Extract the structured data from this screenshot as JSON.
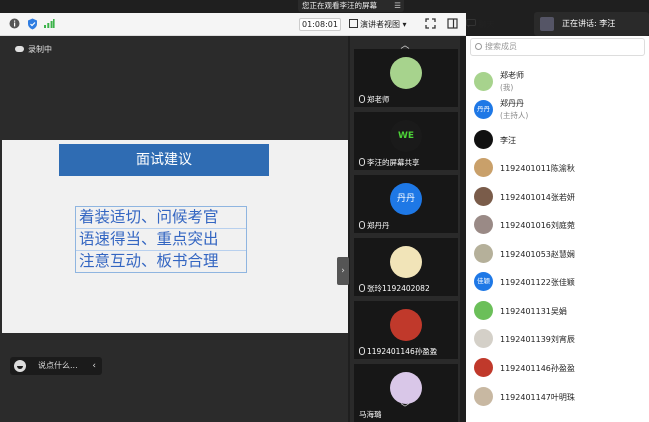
{
  "banner": {
    "text": "您正在观看李汪的屏幕",
    "menu_icon": "☰"
  },
  "toolbar": {
    "timer": "01:08:01",
    "view_label": "演讲者视图",
    "view_caret": "▾",
    "chat_label": "聊天",
    "icons": [
      "info-icon",
      "shield-icon",
      "signal-icon",
      "fullscreen-icon",
      "sidebar-icon",
      "chat-icon"
    ]
  },
  "speaker": {
    "text": "正在讲话: 李汪"
  },
  "stage": {
    "rec_label": "录制中",
    "slide_title": "面试建议",
    "slide_lines": [
      "着装适切、问候考官",
      "语速得当、重点突出",
      "注意互动、板书合理"
    ],
    "chat_placeholder": "说点什么...",
    "chat_chevron": "‹",
    "handle": "›"
  },
  "videos": {
    "up_arrow": "︿",
    "down_arrow": "﹀",
    "tiles": [
      {
        "label": "郑老师",
        "avatar_color": "#a7d38d"
      },
      {
        "label": "李汪的屏幕共享",
        "avatar_color": "#1a1a1a",
        "avatar_text": "WE"
      },
      {
        "label": "郑丹丹",
        "avatar_color": "#1e78e6",
        "avatar_text": "丹丹"
      },
      {
        "label": "张玲1192402082",
        "avatar_color": "#f1e4b8"
      },
      {
        "label": "1192401146孙盈盈",
        "avatar_color": "#c0392b"
      },
      {
        "label": "马海璐",
        "avatar_color": "#d9c7e8"
      }
    ]
  },
  "panel": {
    "search_placeholder": "搜索成员",
    "members": [
      {
        "name": "郑老师",
        "sub": "(我)",
        "color": "#a7d38d"
      },
      {
        "name": "郑丹丹",
        "sub": "(主持人)",
        "color": "#1e78e6",
        "avatar_text": "丹丹"
      },
      {
        "name": "李汪",
        "color": "#111"
      },
      {
        "name": "1192401011陈渝秋",
        "color": "#c9a06a"
      },
      {
        "name": "1192401014张若妍",
        "color": "#7a5c4a"
      },
      {
        "name": "1192401016刘庭菀",
        "color": "#9a8a86"
      },
      {
        "name": "1192401053赵慧娴",
        "color": "#b5b09a"
      },
      {
        "name": "1192401122张佳颖",
        "color": "#1e78e6",
        "avatar_text": "佳颖"
      },
      {
        "name": "1192401131吴娟",
        "color": "#6bbf59"
      },
      {
        "name": "1192401139刘宵辰",
        "color": "#d4d0c8"
      },
      {
        "name": "1192401146孙盈盈",
        "color": "#c0392b"
      },
      {
        "name": "1192401147叶明珠",
        "color": "#c8b8a2"
      }
    ]
  }
}
